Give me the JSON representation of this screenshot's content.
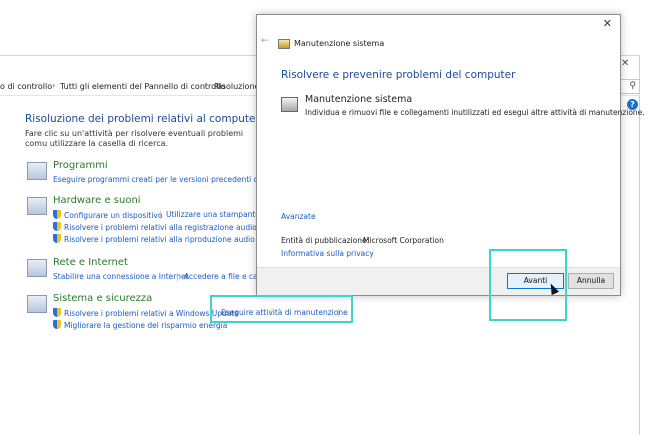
{
  "control_panel": {
    "breadcrumbs": [
      "o di controllo",
      "Tutti gli elementi del Pannello di controllo",
      "Risoluzione"
    ],
    "search_icon": "search-icon",
    "help_label": "?",
    "close_glyph": "✕",
    "title": "Risoluzione dei problemi relativi al computer",
    "description": "Fare clic su un'attività per risolvere eventuali problemi comu utilizzare la casella di ricerca.",
    "categories": [
      {
        "title": "Programmi",
        "links": [
          "Eseguire programmi creati per le versioni precedenti di Windo"
        ]
      },
      {
        "title": "Hardware e suoni",
        "links": [
          "Configurare un dispositivo",
          "Utilizzare una stampante",
          "Risolvere i problemi relativi alla registrazione audio",
          "Risolvere i problemi relativi alla riproduzione audio"
        ]
      },
      {
        "title": "Rete e Internet",
        "links": [
          "Stabilire una connessione a Internet",
          "Accedere a file e cart"
        ]
      },
      {
        "title": "Sistema e sicurezza",
        "links": [
          "Risolvere i problemi relativi a Windows Update",
          "Eseguire attività di manutenzione",
          "Migliorare la gestione del risparmio energia"
        ]
      }
    ]
  },
  "dialog": {
    "close_glyph": "✕",
    "back_glyph": "←",
    "header_title": "Manutenzione sistema",
    "heading": "Risolvere e prevenire problemi del computer",
    "task_title": "Manutenzione sistema",
    "task_description": "Individua e rimuovi file e collegamenti inutilizzati ed esegui altre attività di manutenzione.",
    "advanced_link": "Avanzate",
    "publisher_label": "Entità di pubblicazione:",
    "publisher_value": "Microsoft Corporation",
    "privacy_link": "Informativa sulla privacy",
    "next_button": "Avanti",
    "cancel_button": "Annulla"
  },
  "colors": {
    "accent": "#1a4a9a",
    "link": "#1a5bc4",
    "category": "#2b7a2b",
    "highlight": "#3fd4c9"
  }
}
